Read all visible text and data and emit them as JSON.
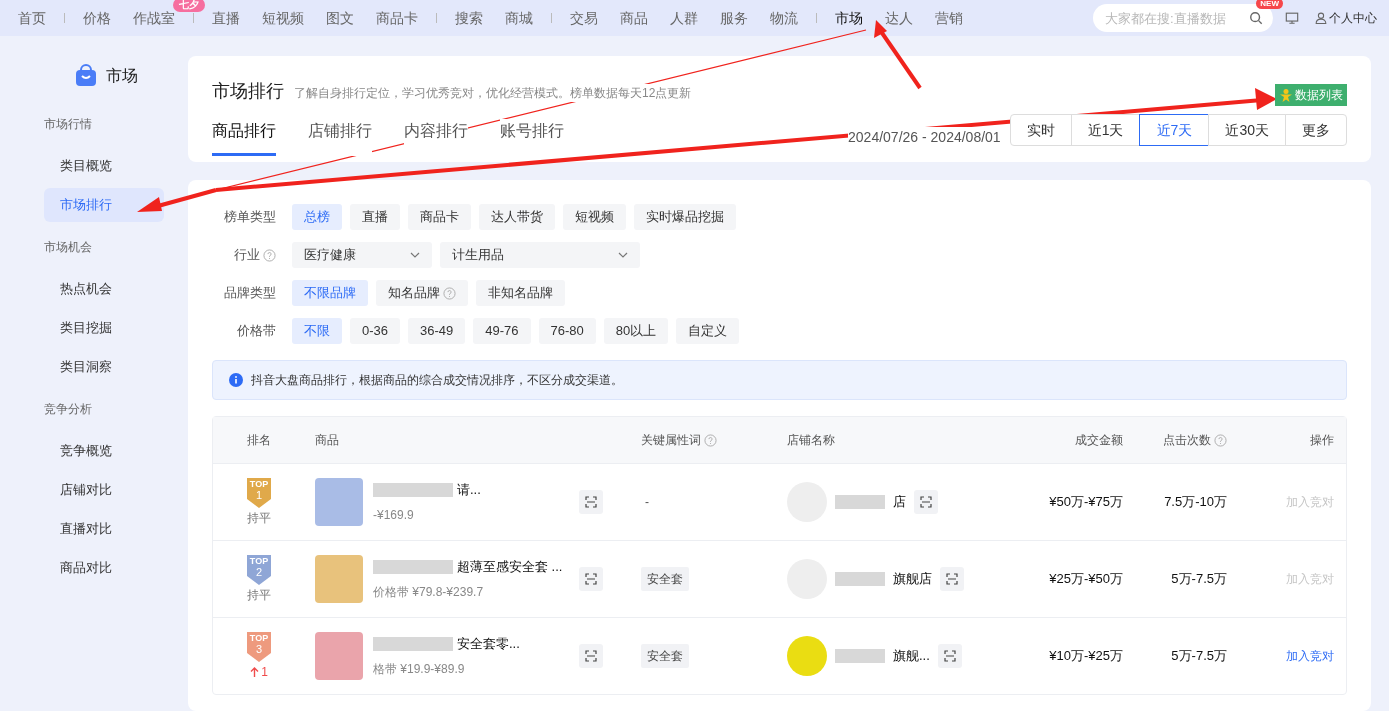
{
  "top_nav": {
    "groups": [
      [
        {
          "label": "首页",
          "selected": false
        }
      ],
      [
        {
          "label": "价格",
          "selected": false
        },
        {
          "label": "作战室",
          "selected": false,
          "badge": "七夕"
        }
      ],
      [
        {
          "label": "直播",
          "selected": false
        },
        {
          "label": "短视频",
          "selected": false
        },
        {
          "label": "图文",
          "selected": false
        },
        {
          "label": "商品卡",
          "selected": false
        }
      ],
      [
        {
          "label": "搜索",
          "selected": false
        },
        {
          "label": "商城",
          "selected": false
        }
      ],
      [
        {
          "label": "交易",
          "selected": false
        },
        {
          "label": "商品",
          "selected": false
        },
        {
          "label": "人群",
          "selected": false
        },
        {
          "label": "服务",
          "selected": false
        },
        {
          "label": "物流",
          "selected": false
        }
      ],
      [
        {
          "label": "市场",
          "selected": true
        },
        {
          "label": "达人",
          "selected": false
        },
        {
          "label": "营销",
          "selected": false
        }
      ]
    ],
    "search": {
      "placeholder": "大家都在搜:直播数据"
    },
    "new_badge": "NEW",
    "user": "个人中心"
  },
  "sidebar": {
    "title": "市场",
    "sections": [
      {
        "heading": "市场行情",
        "items": [
          {
            "label": "类目概览",
            "selected": false
          },
          {
            "label": "市场排行",
            "selected": true
          }
        ]
      },
      {
        "heading": "市场机会",
        "items": [
          {
            "label": "热点机会",
            "selected": false
          },
          {
            "label": "类目挖掘",
            "selected": false
          },
          {
            "label": "类目洞察",
            "selected": false
          }
        ]
      },
      {
        "heading": "竞争分析",
        "items": [
          {
            "label": "竞争概览",
            "selected": false
          },
          {
            "label": "店铺对比",
            "selected": false
          },
          {
            "label": "直播对比",
            "selected": false
          },
          {
            "label": "商品对比",
            "selected": false
          }
        ]
      }
    ]
  },
  "header": {
    "title": "市场排行",
    "subtitle": "了解自身排行定位，学习优秀竞对，优化经营模式。榜单数据每天12点更新",
    "data_list_button": "数据列表",
    "tabs": [
      {
        "label": "商品排行",
        "selected": true
      },
      {
        "label": "店铺排行",
        "selected": false
      },
      {
        "label": "内容排行",
        "selected": false
      },
      {
        "label": "账号排行",
        "selected": false
      }
    ],
    "date_range": "2024/07/26 - 2024/08/01",
    "periods": [
      {
        "label": "实时",
        "selected": false
      },
      {
        "label": "近1天",
        "selected": false
      },
      {
        "label": "近7天",
        "selected": true
      },
      {
        "label": "近30天",
        "selected": false
      },
      {
        "label": "更多",
        "selected": false
      }
    ]
  },
  "filters": [
    {
      "kind": "chips",
      "label": "榜单类型",
      "options": [
        {
          "label": "总榜",
          "selected": true
        },
        {
          "label": "直播",
          "selected": false
        },
        {
          "label": "商品卡",
          "selected": false
        },
        {
          "label": "达人带货",
          "selected": false
        },
        {
          "label": "短视频",
          "selected": false
        },
        {
          "label": "实时爆品挖掘",
          "selected": false
        }
      ]
    },
    {
      "kind": "dropdowns",
      "label": "行业",
      "help": true,
      "options": [
        {
          "label": "医疗健康"
        },
        {
          "label": "计生用品"
        }
      ]
    },
    {
      "kind": "chips",
      "label": "品牌类型",
      "options": [
        {
          "label": "不限品牌",
          "selected": true
        },
        {
          "label": "知名品牌",
          "selected": false,
          "help": true
        },
        {
          "label": "非知名品牌",
          "selected": false
        }
      ]
    },
    {
      "kind": "chips",
      "label": "价格带",
      "options": [
        {
          "label": "不限",
          "selected": true
        },
        {
          "label": "0-36",
          "selected": false
        },
        {
          "label": "36-49",
          "selected": false
        },
        {
          "label": "49-76",
          "selected": false
        },
        {
          "label": "76-80",
          "selected": false
        },
        {
          "label": "80以上",
          "selected": false
        },
        {
          "label": "自定义",
          "selected": false
        }
      ]
    }
  ],
  "notice": "抖音大盘商品排行，根据商品的综合成交情况排序，不区分成交渠道。",
  "table": {
    "columns": [
      {
        "label": "排名"
      },
      {
        "label": "商品"
      },
      {
        "label": "关键属性词",
        "help": true
      },
      {
        "label": "店铺名称"
      },
      {
        "label": "成交金额"
      },
      {
        "label": "点击次数",
        "help": true
      },
      {
        "label": "操作"
      }
    ],
    "rows": [
      {
        "medal_label": "TOP",
        "rank": "1",
        "rank_change": {
          "kind": "flat",
          "text": "持平"
        },
        "product_name": "请...",
        "product_price": "-¥169.9",
        "keyword": "-",
        "store_name": "店",
        "amount": "¥50万-¥75万",
        "clicks": "7.5万-10万",
        "action": "加入竞对",
        "action_disabled": true
      },
      {
        "medal_label": "TOP",
        "rank": "2",
        "rank_change": {
          "kind": "flat",
          "text": "持平"
        },
        "product_name": "超薄至感安全套 ...",
        "product_price": "价格带 ¥79.8-¥239.7",
        "keyword": "安全套",
        "store_name": "旗舰店",
        "amount": "¥25万-¥50万",
        "clicks": "5万-7.5万",
        "action": "加入竞对",
        "action_disabled": true
      },
      {
        "medal_label": "TOP",
        "rank": "3",
        "rank_change": {
          "kind": "up",
          "text": "1"
        },
        "product_name": "安全套零...",
        "product_price": "格带 ¥19.9-¥89.9",
        "keyword": "安全套",
        "store_name": "旗舰...",
        "amount": "¥10万-¥25万",
        "clicks": "5万-7.5万",
        "action": "加入竞对",
        "action_disabled": false
      }
    ]
  }
}
